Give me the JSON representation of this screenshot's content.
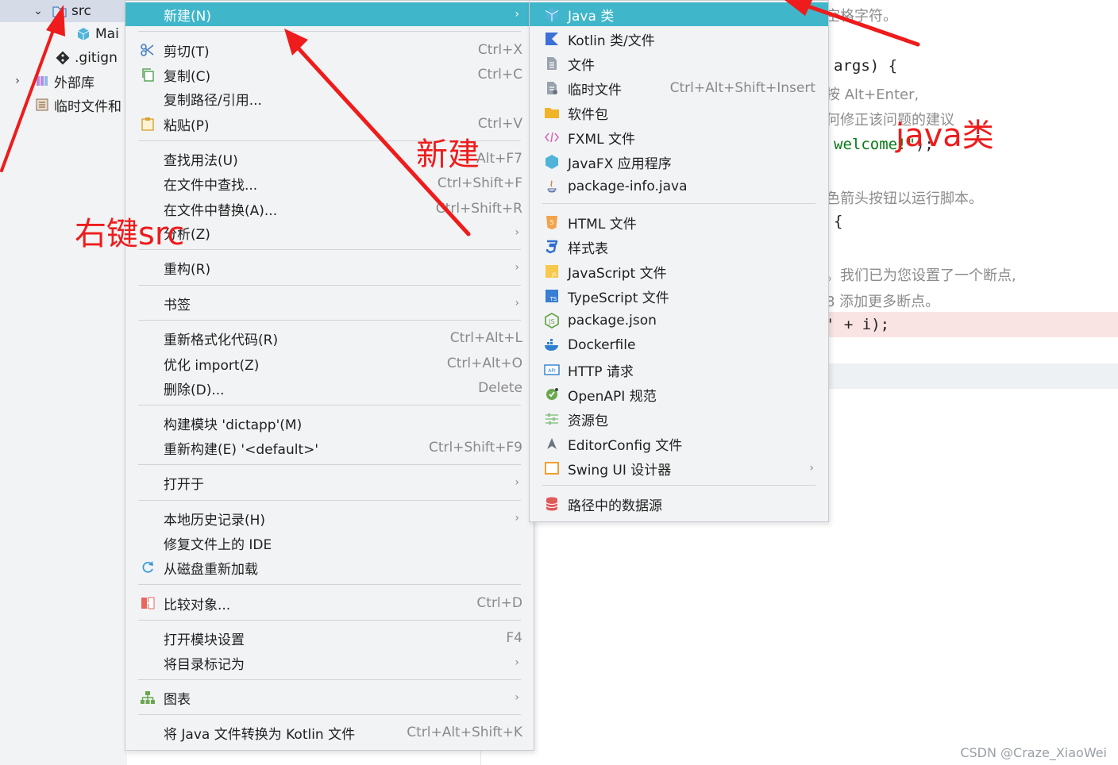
{
  "tree": {
    "rows": [
      {
        "label": "src",
        "icon": "folder-icon",
        "expanded": true
      },
      {
        "label": "Mai",
        "icon": "java-class-icon"
      },
      {
        "label": ".gitign",
        "icon": "git-icon"
      },
      {
        "label": "外部库",
        "icon": "library-icon",
        "expanded": false
      },
      {
        "label": "临时文件和",
        "icon": "scratch-icon"
      }
    ]
  },
  "editor": {
    "lines": [
      {
        "kind": "comment",
        "text": "空格字符。"
      },
      {
        "kind": "code",
        "text": "args) {"
      },
      {
        "kind": "comment",
        "text": "按 Alt+Enter,"
      },
      {
        "kind": "comment",
        "text": "何修正该问题的建议"
      },
      {
        "kind": "code_str",
        "pre": "",
        "str": "welcome!\"",
        "post": ");"
      },
      {
        "kind": "comment",
        "text": "色箭头按钮以运行脚本。"
      },
      {
        "kind": "code",
        "text": "{"
      },
      {
        "kind": "comment",
        "text": "。我们已为您设置了一个断点,"
      },
      {
        "kind": "comment",
        "text": "8 添加更多断点。"
      },
      {
        "kind": "code",
        "text": "' + i);"
      }
    ]
  },
  "context_menu": {
    "items": [
      {
        "label": "新建(N)",
        "shortcut": "",
        "submenu": true,
        "highlighted": true,
        "icon": ""
      },
      {
        "label": "剪切(T)",
        "shortcut": "Ctrl+X",
        "icon": "scissors-icon"
      },
      {
        "label": "复制(C)",
        "shortcut": "Ctrl+C",
        "icon": "copy-icon"
      },
      {
        "label": "复制路径/引用...",
        "shortcut": "",
        "icon": ""
      },
      {
        "label": "粘贴(P)",
        "shortcut": "Ctrl+V",
        "icon": "paste-icon"
      },
      {
        "label": "查找用法(U)",
        "shortcut": "Alt+F7",
        "icon": ""
      },
      {
        "label": "在文件中查找...",
        "shortcut": "Ctrl+Shift+F",
        "icon": ""
      },
      {
        "label": "在文件中替换(A)...",
        "shortcut": "Ctrl+Shift+R",
        "icon": ""
      },
      {
        "label": "分析(Z)",
        "shortcut": "",
        "submenu": true,
        "icon": ""
      },
      {
        "label": "重构(R)",
        "shortcut": "",
        "submenu": true,
        "icon": ""
      },
      {
        "label": "书签",
        "shortcut": "",
        "submenu": true,
        "icon": ""
      },
      {
        "label": "重新格式化代码(R)",
        "shortcut": "Ctrl+Alt+L",
        "icon": ""
      },
      {
        "label": "优化 import(Z)",
        "shortcut": "Ctrl+Alt+O",
        "icon": ""
      },
      {
        "label": "删除(D)...",
        "shortcut": "Delete",
        "icon": ""
      },
      {
        "label": "构建模块 'dictapp'(M)",
        "shortcut": "",
        "icon": ""
      },
      {
        "label": "重新构建(E) '<default>'",
        "shortcut": "Ctrl+Shift+F9",
        "icon": ""
      },
      {
        "label": "打开于",
        "shortcut": "",
        "submenu": true,
        "icon": ""
      },
      {
        "label": "本地历史记录(H)",
        "shortcut": "",
        "submenu": true,
        "icon": ""
      },
      {
        "label": "修复文件上的 IDE",
        "shortcut": "",
        "icon": ""
      },
      {
        "label": "从磁盘重新加载",
        "shortcut": "",
        "icon": "reload-icon"
      },
      {
        "label": "比较对象...",
        "shortcut": "Ctrl+D",
        "icon": "compare-icon"
      },
      {
        "label": "打开模块设置",
        "shortcut": "F4",
        "icon": ""
      },
      {
        "label": "将目录标记为",
        "shortcut": "",
        "submenu": true,
        "icon": ""
      },
      {
        "label": "图表",
        "shortcut": "",
        "submenu": true,
        "icon": "diagram-icon"
      },
      {
        "label": "将 Java 文件转换为 Kotlin 文件",
        "shortcut": "Ctrl+Alt+Shift+K",
        "icon": ""
      }
    ]
  },
  "new_submenu": {
    "items": [
      {
        "label": "Java 类",
        "shortcut": "",
        "highlighted": true,
        "icon": "java-class-icon"
      },
      {
        "label": "Kotlin 类/文件",
        "shortcut": "",
        "icon": "kotlin-icon"
      },
      {
        "label": "文件",
        "shortcut": "",
        "icon": "file-icon"
      },
      {
        "label": "临时文件",
        "shortcut": "Ctrl+Alt+Shift+Insert",
        "icon": "scratch-file-icon"
      },
      {
        "label": "软件包",
        "shortcut": "",
        "icon": "package-folder-icon"
      },
      {
        "label": "FXML 文件",
        "shortcut": "",
        "icon": "fxml-icon"
      },
      {
        "label": "JavaFX 应用程序",
        "shortcut": "",
        "icon": "javafx-icon"
      },
      {
        "label": "package-info.java",
        "shortcut": "",
        "icon": "java-file-icon"
      },
      {
        "label": "HTML 文件",
        "shortcut": "",
        "icon": "html-icon"
      },
      {
        "label": "样式表",
        "shortcut": "",
        "icon": "css-icon"
      },
      {
        "label": "JavaScript 文件",
        "shortcut": "",
        "icon": "javascript-icon"
      },
      {
        "label": "TypeScript 文件",
        "shortcut": "",
        "icon": "typescript-icon"
      },
      {
        "label": "package.json",
        "shortcut": "",
        "icon": "nodejs-icon"
      },
      {
        "label": "Dockerfile",
        "shortcut": "",
        "icon": "docker-icon"
      },
      {
        "label": "HTTP 请求",
        "shortcut": "",
        "icon": "api-icon"
      },
      {
        "label": "OpenAPI 规范",
        "shortcut": "",
        "icon": "openapi-icon"
      },
      {
        "label": "资源包",
        "shortcut": "",
        "icon": "resource-bundle-icon"
      },
      {
        "label": "EditorConfig 文件",
        "shortcut": "",
        "icon": "editorconfig-icon"
      },
      {
        "label": "Swing UI 设计器",
        "shortcut": "",
        "submenu": true,
        "icon": "swing-form-icon"
      },
      {
        "label": "路径中的数据源",
        "shortcut": "",
        "icon": "database-icon"
      }
    ]
  },
  "annotations": {
    "right_click_src": "右键src",
    "new": "新建",
    "java_class": "java类",
    "color": "#ee1c1c"
  },
  "watermark": "CSDN @Craze_XiaoWei",
  "colors": {
    "highlight": "#3fb6c9",
    "menu_bg": "#f2f3f5"
  }
}
